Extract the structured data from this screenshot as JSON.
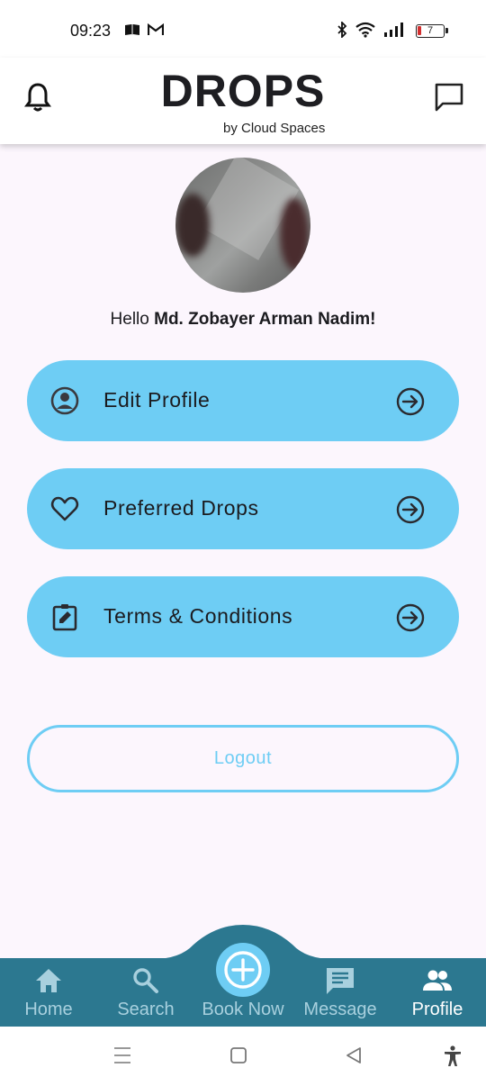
{
  "status_bar": {
    "time": "09:23",
    "battery_level": "7",
    "left_icons": [
      "book-icon",
      "gmail-icon"
    ],
    "right_icons": [
      "bluetooth-icon",
      "wifi-icon",
      "signal-icon",
      "battery-icon"
    ]
  },
  "header": {
    "title": "DROPS",
    "subtitle": "by Cloud Spaces",
    "left_icon": "bell-icon",
    "right_icon": "chat-icon"
  },
  "profile": {
    "greeting_prefix": "Hello",
    "user_name": "Md. Zobayer Arman Nadim!"
  },
  "menu": [
    {
      "label": "Edit Profile",
      "icon": "account-circle-icon"
    },
    {
      "label": "Preferred Drops",
      "icon": "heart-icon"
    },
    {
      "label": "Terms & Conditions",
      "icon": "clipboard-edit-icon"
    }
  ],
  "logout": {
    "label": "Logout"
  },
  "bottom_nav": {
    "items": [
      {
        "label": "Home",
        "icon": "home-icon"
      },
      {
        "label": "Search",
        "icon": "search-icon"
      },
      {
        "label": "Book Now",
        "icon": "plus-circle-icon"
      },
      {
        "label": "Message",
        "icon": "message-icon"
      },
      {
        "label": "Profile",
        "icon": "people-icon"
      }
    ],
    "active": "Profile"
  },
  "colors": {
    "accent": "#6ecdf4",
    "nav_bg": "#2c7890",
    "page_bg": "#fcf6fd"
  }
}
